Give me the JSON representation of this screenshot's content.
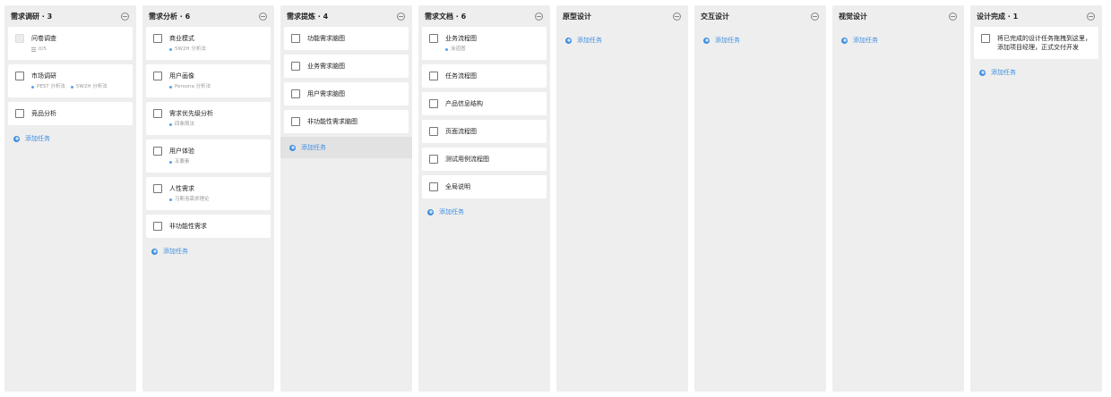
{
  "columns": [
    {
      "title": "需求调研 · 3",
      "cards": [
        {
          "title": "问卷调查",
          "disabled": true,
          "sub": {
            "type": "list",
            "text": "0/5"
          }
        },
        {
          "title": "市场调研",
          "tags": [
            "PEST 分析法",
            "5W2H 分析法"
          ]
        },
        {
          "title": "竞品分析"
        }
      ],
      "add_label": "添加任务"
    },
    {
      "title": "需求分析 · 6",
      "cards": [
        {
          "title": "商业模式",
          "tags": [
            "5W2H 分析法"
          ]
        },
        {
          "title": "用户画像",
          "tags": [
            "Persona 分析法"
          ]
        },
        {
          "title": "需求优先级分析",
          "tags": [
            "四象限法"
          ]
        },
        {
          "title": "用户体验",
          "tags": [
            "五要素"
          ]
        },
        {
          "title": "人性需求",
          "tags": [
            "马斯洛需求理论"
          ]
        },
        {
          "title": "非功能性需求"
        }
      ],
      "add_label": "添加任务"
    },
    {
      "title": "需求提炼 · 4",
      "cards": [
        {
          "title": "功能需求脑图"
        },
        {
          "title": "业务需求脑图"
        },
        {
          "title": "用户需求脑图"
        },
        {
          "title": "非功能性需求脑图"
        }
      ],
      "add_label": "添加任务",
      "add_highlight": true
    },
    {
      "title": "需求文档 · 6",
      "cards": [
        {
          "title": "业务流程图",
          "tags": [
            "泳道图"
          ]
        },
        {
          "title": "任务流程图"
        },
        {
          "title": "产品信息结构"
        },
        {
          "title": "页面流程图"
        },
        {
          "title": "测试用例流程图"
        },
        {
          "title": "全局说明"
        }
      ],
      "add_label": "添加任务"
    },
    {
      "title": "原型设计",
      "cards": [],
      "add_label": "添加任务"
    },
    {
      "title": "交互设计",
      "cards": [],
      "add_label": "添加任务"
    },
    {
      "title": "视觉设计",
      "cards": [],
      "add_label": "添加任务"
    },
    {
      "title": "设计完成 · 1",
      "cards": [
        {
          "title": "将已完成的设计任务拖拽到这里，添加项目经理，正式交付开发",
          "multiline": true
        }
      ],
      "add_label": "添加任务"
    }
  ],
  "colors": {
    "accent": "#3f8fe0",
    "column_bg": "#eeeeee",
    "card_bg": "#ffffff"
  },
  "icons": {
    "collapse": "minus-circle-icon",
    "add": "plus-circle-icon",
    "checkbox": "checkbox-icon",
    "tag": "dot-icon",
    "list": "checklist-icon"
  }
}
